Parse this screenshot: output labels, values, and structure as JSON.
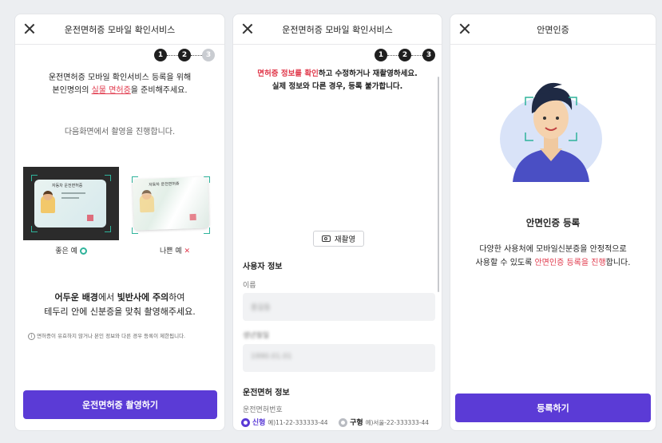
{
  "screen1": {
    "title": "운전면허증 모바일 확인서비스",
    "steps": [
      "1",
      "2",
      "3"
    ],
    "intro_line1": "운전면허증 모바일 확인서비스 등록을 위해",
    "intro_line2_pre": "본인명의의 ",
    "intro_line2_red": "실물 면허증",
    "intro_line2_post": "을 준비해주세요.",
    "next_notice": "다음화면에서 촬영을 진행합니다.",
    "card_label": "자동차 운전면허증",
    "good_caption": "좋은 예",
    "bad_caption": "나쁜 예",
    "tip_line1_b1": "어두운 배경",
    "tip_line1_m1": "에서 ",
    "tip_line1_b2": "빛반사에 주의",
    "tip_line1_m2": "하여",
    "tip_line2": "테두리 안에 신분증을 맞춰 촬영해주세요.",
    "notice": "면허증이 유효하지 않거나 본인 정보와 다른 경우 등록이 제한됩니다.",
    "cta": "운전면허증 촬영하기"
  },
  "screen2": {
    "title": "운전면허증 모바일 확인서비스",
    "steps": [
      "1",
      "2",
      "3"
    ],
    "warn_red": "면허증 정보를 확인",
    "warn_rest": "하고 수정하거나 재촬영하세요.",
    "warn_line2": "실제 정보와 다른 경우, 등록 불가합니다.",
    "retake": "재촬영",
    "user_section": "사용자 정보",
    "name_label": "이름",
    "name_value": "홍길동",
    "birth_label": "생년월일",
    "birth_value": "1990.01.01",
    "license_section": "운전면허 정보",
    "license_label": "운전면허번호",
    "new_option": "신형",
    "new_example": "예)11-22-333333-44",
    "old_option": "구형",
    "old_example": "예)서울-22-333333-44"
  },
  "screen3": {
    "title": "안면인증",
    "heading": "안면인증 등록",
    "desc_line1": "다양한 사용처에 모바일신분증을 안정적으로",
    "desc_line2_pre": "사용할 수 있도록 ",
    "desc_line2_red": "안면인증 등록을 진행",
    "desc_line2_post": "합니다.",
    "cta": "등록하기"
  },
  "colors": {
    "accent": "#5b3bd6",
    "red": "#e0384b",
    "green": "#2fb39b"
  },
  "icons": [
    "close-icon",
    "camera-icon",
    "info-icon",
    "check-circle-icon",
    "x-mark-icon"
  ]
}
